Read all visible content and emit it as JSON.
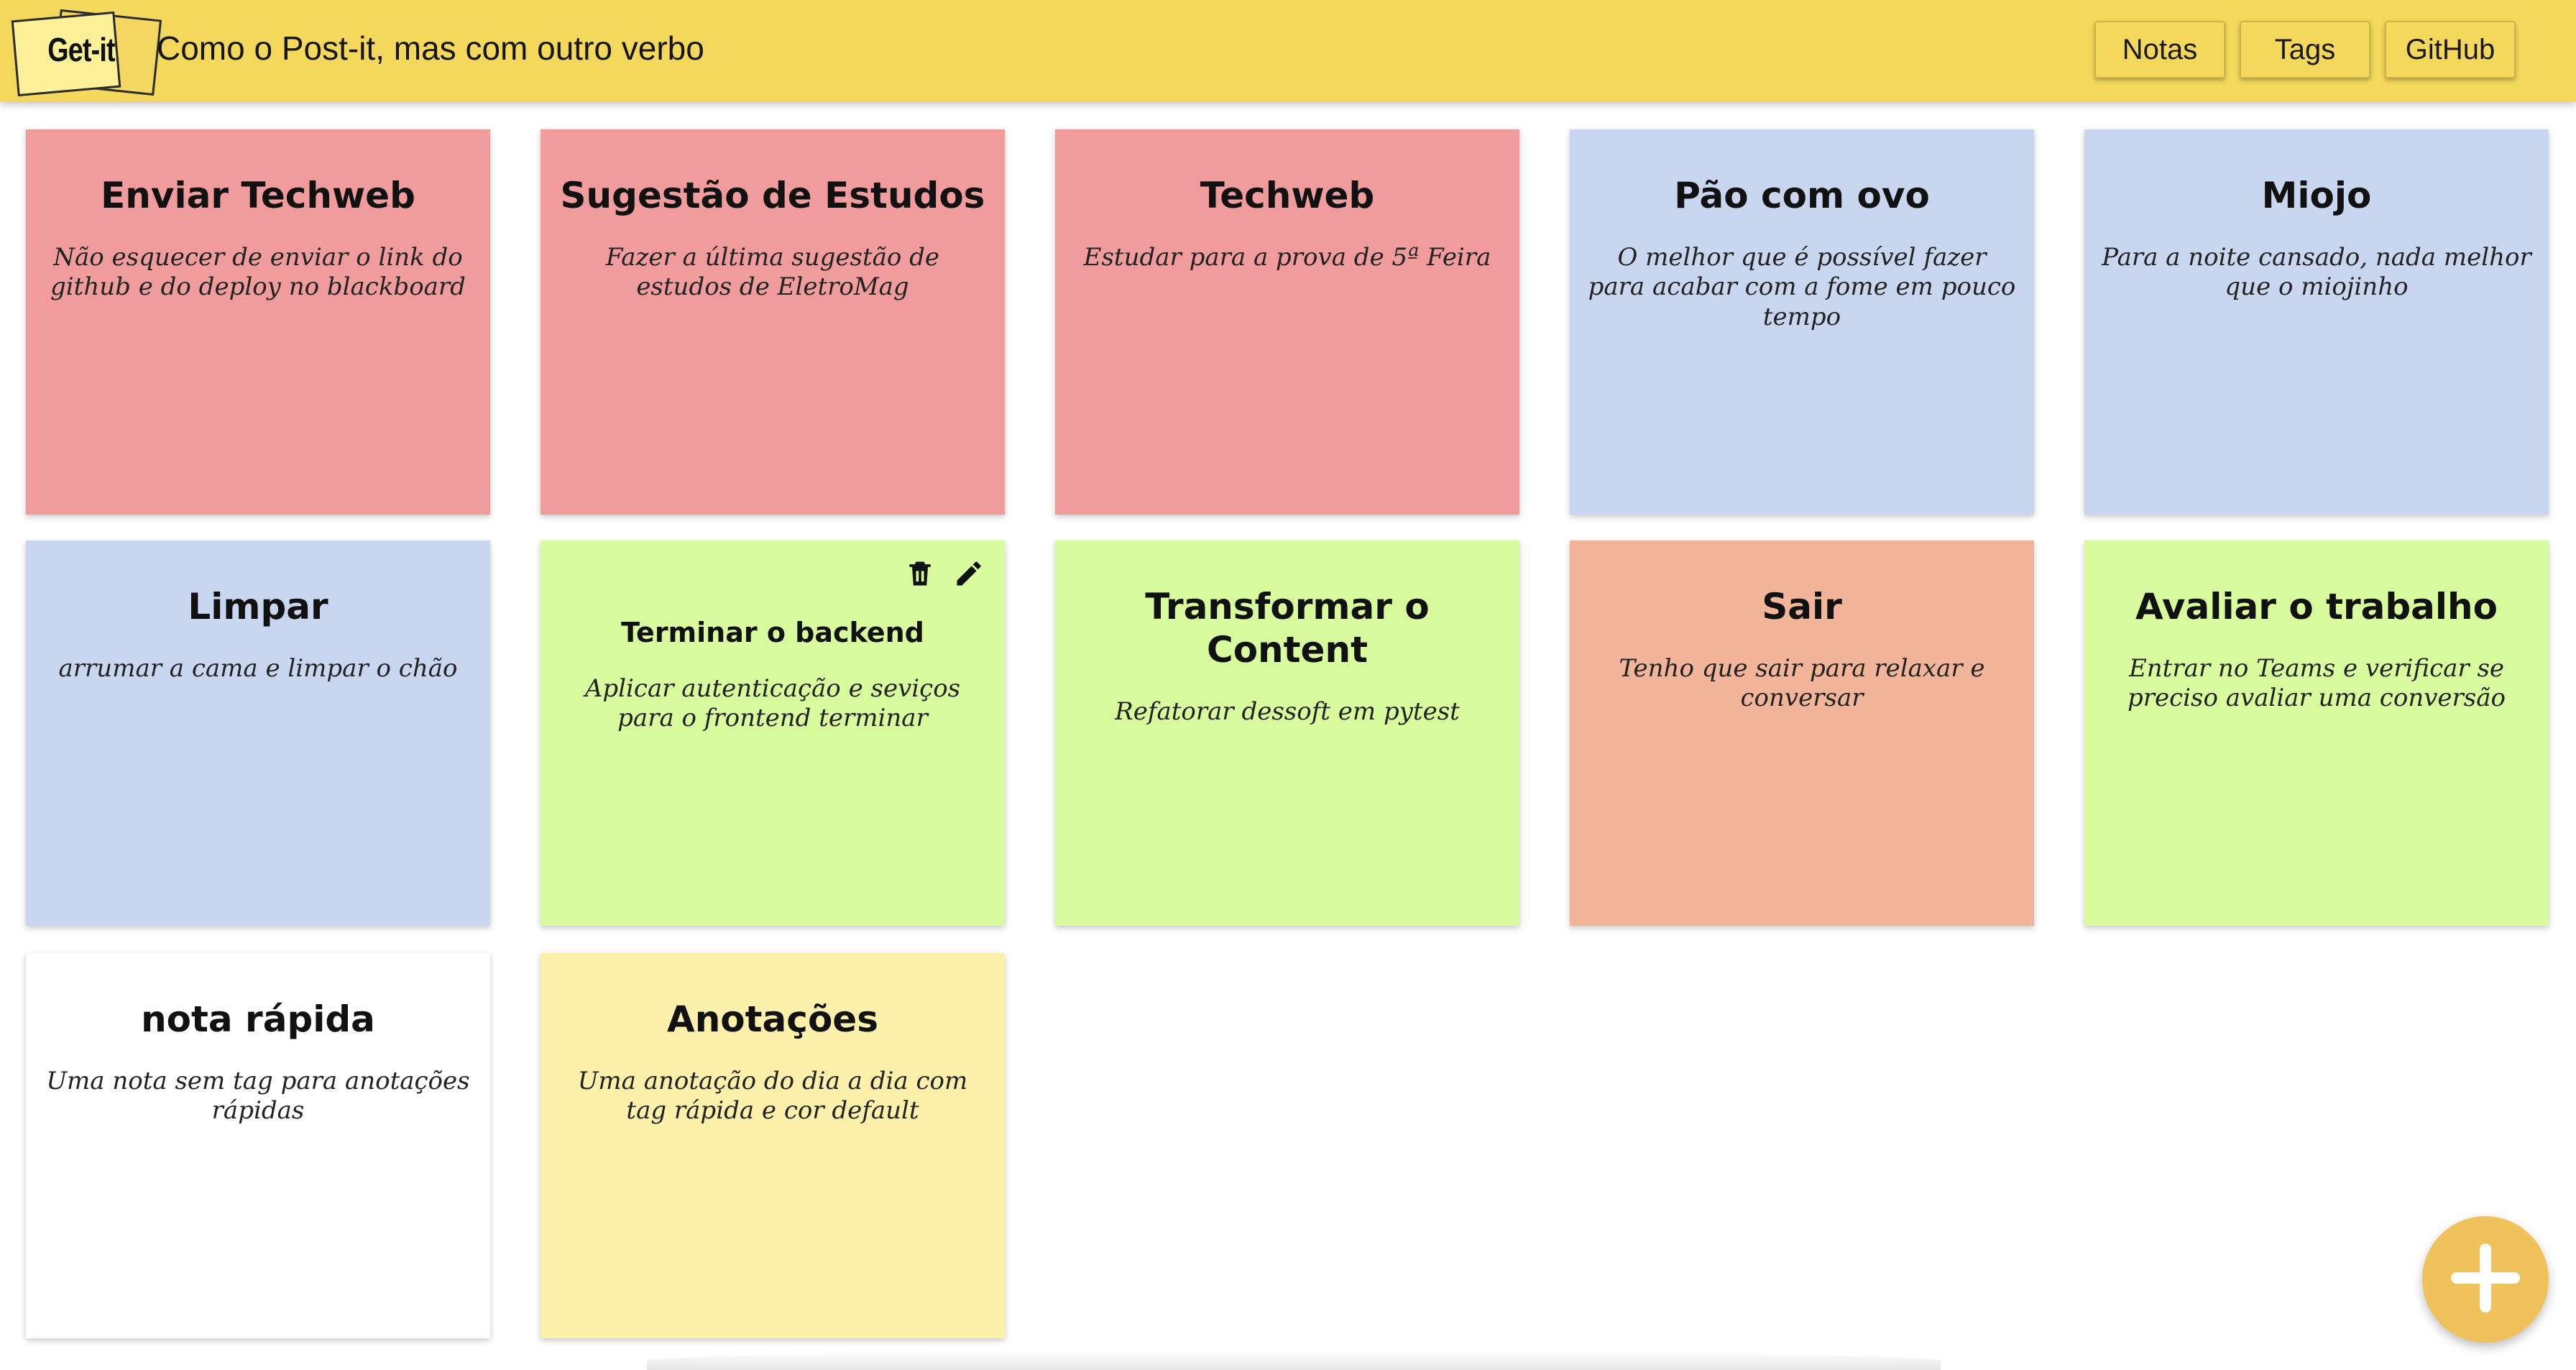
{
  "header": {
    "logo_text": "Get-it",
    "tagline": "Como o Post-it, mas com outro verbo",
    "nav": {
      "notas": "Notas",
      "tags": "Tags",
      "github": "GitHub"
    },
    "background": "#f4d85c"
  },
  "notes": [
    {
      "title": "Enviar Techweb",
      "body": "Não esquecer de enviar o link do github e do deploy no blackboard",
      "color": "#f09c9c"
    },
    {
      "title": "Sugestão de Estudos",
      "body": "Fazer a última sugestão de estudos de EletroMag",
      "color": "#f09c9c"
    },
    {
      "title": "Techweb",
      "body": "Estudar para a prova de 5ª Feira",
      "color": "#f09c9c"
    },
    {
      "title": "Pão com ovo",
      "body": "O melhor que é possível fazer para acabar com a fome em pouco tempo",
      "color": "#c8d7ef"
    },
    {
      "title": "Miojo",
      "body": "Para a noite cansado, nada melhor que o miojinho",
      "color": "#c8d7ef"
    },
    {
      "title": "Limpar",
      "body": "arrumar a cama e limpar o chão",
      "color": "#c8d7ef"
    },
    {
      "title": "Terminar o backend",
      "body": "Aplicar autenticação e seviços para o frontend terminar",
      "color": "#d7fb9d",
      "hovered": true
    },
    {
      "title": "Transformar o Content",
      "body": "Refatorar dessoft em pytest",
      "color": "#d7fb9d"
    },
    {
      "title": "Sair",
      "body": "Tenho que sair para relaxar e conversar",
      "color": "#f2b59a"
    },
    {
      "title": "Avaliar o trabalho",
      "body": "Entrar no Teams e verificar se preciso avaliar uma conversão",
      "color": "#d7fb9d"
    },
    {
      "title": "nota rápida",
      "body": "Uma nota sem tag para anotações rápidas",
      "color": "#ffffff"
    },
    {
      "title": "Anotações",
      "body": "Uma anotação do dia a dia com tag rápida e cor default",
      "color": "#fcf0ab"
    }
  ],
  "icons": {
    "delete": "trash-icon",
    "edit": "pencil-icon",
    "add": "plus-icon"
  },
  "fab_color": "#f0c25c"
}
